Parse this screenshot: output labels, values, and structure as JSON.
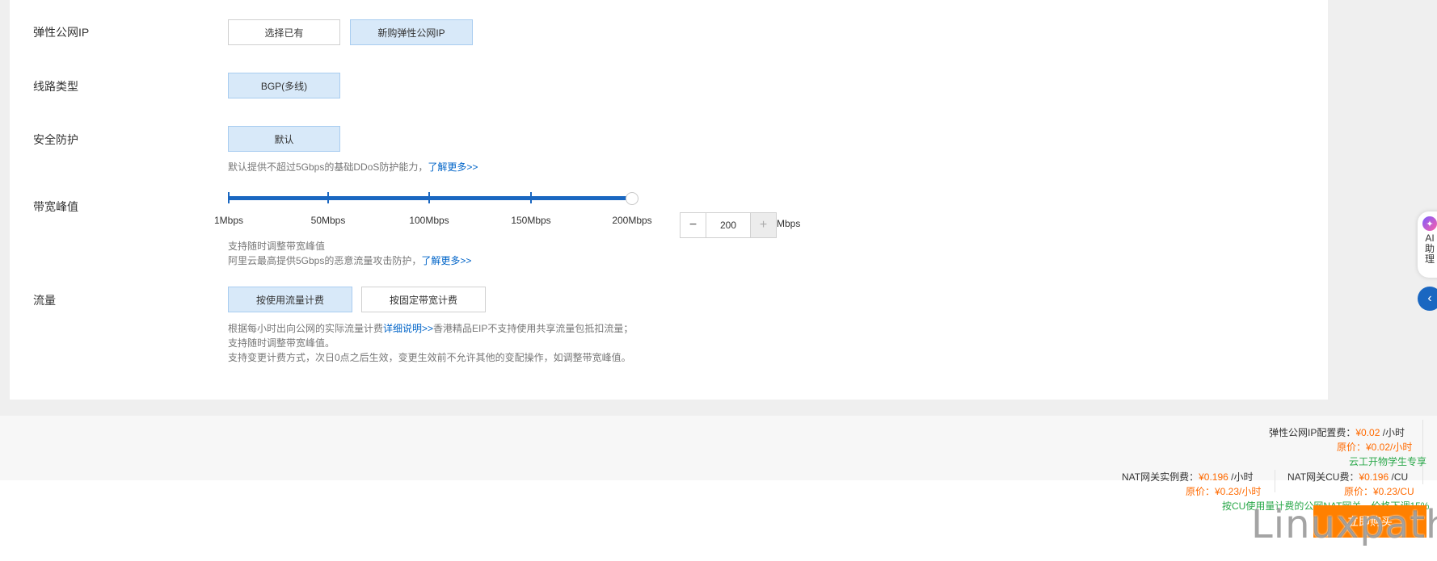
{
  "eip": {
    "label": "弹性公网IP",
    "options": [
      "选择已有",
      "新购弹性公网IP"
    ],
    "selected": "新购弹性公网IP"
  },
  "line_type": {
    "label": "线路类型",
    "options": [
      "BGP(多线)"
    ],
    "selected": "BGP(多线)"
  },
  "security": {
    "label": "安全防护",
    "options": [
      "默认"
    ],
    "selected": "默认",
    "hint": "默认提供不超过5Gbps的基础DDoS防护能力，",
    "hint_link": "了解更多>>"
  },
  "bandwidth": {
    "label": "带宽峰值",
    "slider_labels": [
      "1Mbps",
      "50Mbps",
      "100Mbps",
      "150Mbps",
      "200Mbps"
    ],
    "slider_value": 200,
    "value": "200",
    "unit": "Mbps",
    "minus": "−",
    "plus": "+",
    "hint1": "支持随时调整带宽峰值",
    "hint2": "阿里云最高提供5Gbps的恶意流量攻击防护，",
    "hint2_link": "了解更多>>"
  },
  "traffic": {
    "label": "流量",
    "options": [
      "按使用流量计费",
      "按固定带宽计费"
    ],
    "selected": "按使用流量计费",
    "hint1_pre": "根据每小时出向公网的实际流量计费",
    "hint1_link": "详细说明>>",
    "hint1_post": "香港精品EIP不支持使用共享流量包抵扣流量；",
    "hint2": "支持随时调整带宽峰值。",
    "hint3": "支持变更计费方式，次日0点之后生效，变更生效前不允许其他的变配操作，如调整带宽峰值。"
  },
  "footer": {
    "eip_fee_label": "弹性公网IP配置费：",
    "eip_fee_price": "¥0.02",
    "eip_fee_per": " /小时",
    "eip_fee_orig": "原价：¥0.02/小时",
    "promo1": "云工开物学生专享",
    "nat_fee_label": "NAT网关实例费：",
    "nat_fee_price": "¥0.196",
    "nat_fee_per": " /小时",
    "nat_fee_orig": "原价：¥0.23/小时",
    "nat_cu_label": "NAT网关CU费：",
    "nat_cu_price": "¥0.196",
    "nat_cu_per": " /CU",
    "nat_cu_orig": "原价：¥0.23/CU",
    "promo2": "按CU使用量计费的公网NAT网关，价格下调15%",
    "buy_label": "立即购买"
  },
  "side": {
    "ai_label": "AI助理",
    "collapse_icon": "chevron-left-icon"
  },
  "watermark": "Linuxpath",
  "colors": {
    "accent": "#1a67c1",
    "link": "#0064c8",
    "price": "#ff6a00",
    "promo": "#2aa84a",
    "buy": "#ff8000"
  }
}
